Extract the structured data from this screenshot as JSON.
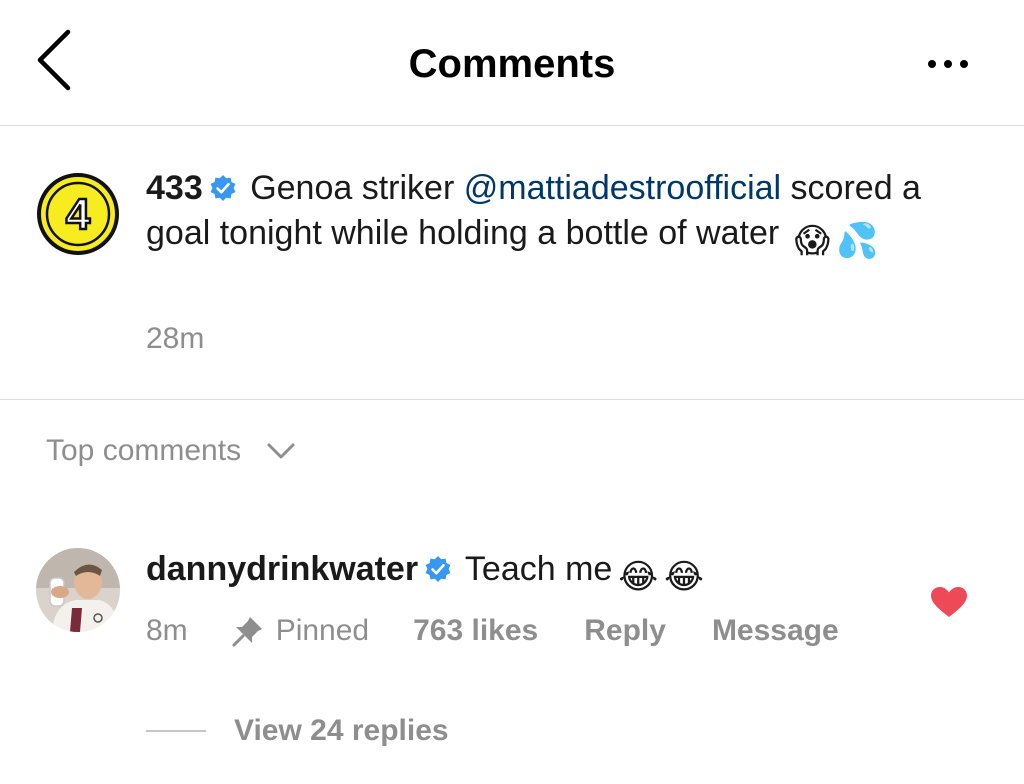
{
  "header": {
    "title": "Comments",
    "back_icon": "chevron-left-icon",
    "more_icon": "more-horizontal-icon"
  },
  "caption": {
    "username": "433",
    "text_before_mention": "Genoa striker",
    "mention": "@mattiadestroofficial",
    "text_after_mention": "scored a goal tonight while holding a bottle of water",
    "emojis": [
      "😱",
      "💦"
    ],
    "time": "28m",
    "avatar_label": "4",
    "verified_icon": "verified-badge-icon"
  },
  "sort": {
    "label": "Top comments",
    "icon": "chevron-down-icon"
  },
  "comment": {
    "username": "dannydrinkwater",
    "text": "Teach me",
    "emojis": [
      "😂",
      "😂"
    ],
    "time": "8m",
    "pinned_label": "Pinned",
    "likes": "763 likes",
    "reply_label": "Reply",
    "message_label": "Message",
    "liked": true,
    "view_replies": "View 24 replies"
  },
  "colors": {
    "text": "#1a1a1a",
    "secondary": "#8e8e8e",
    "mention": "#00376b",
    "verified": "#3897f0",
    "heart": "#ed4956",
    "divider": "#dbdbdb",
    "avatar_433_fill": "#f7ec1f"
  }
}
